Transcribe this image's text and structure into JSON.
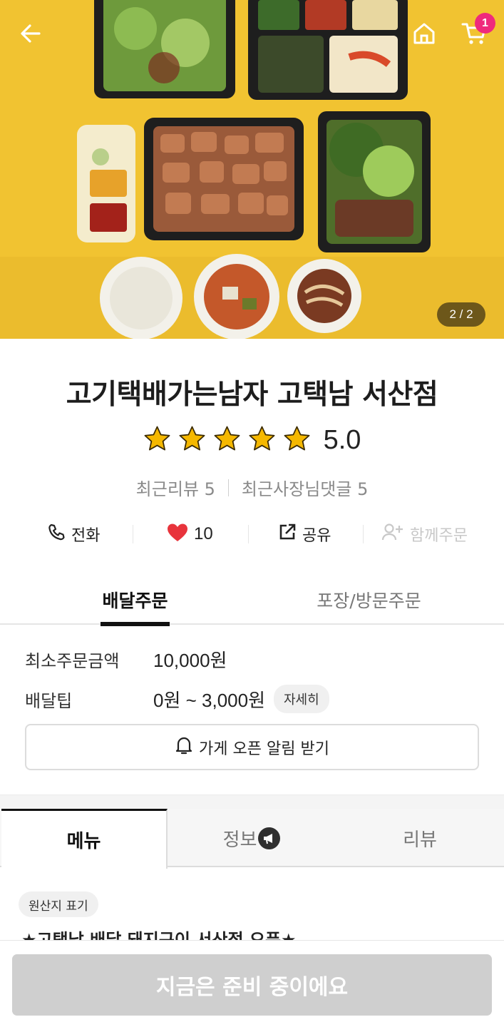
{
  "hero": {
    "page_indicator": "2 / 2",
    "cart_count": "1",
    "icons": {
      "back": "arrow-left-icon",
      "home": "home-icon",
      "cart": "cart-icon"
    }
  },
  "store": {
    "name": "고기택배가는남자 고택남 서산점",
    "rating": "5.0",
    "stars": 5,
    "recent_reviews": "최근리뷰 5",
    "recent_owner_replies": "최근사장님댓글 5"
  },
  "actions": {
    "call": "전화",
    "likes": "10",
    "share": "공유",
    "group_order": "함께주문"
  },
  "order_tabs": {
    "delivery": "배달주문",
    "pickup": "포장/방문주문"
  },
  "info": {
    "min_order_label": "최소주문금액",
    "min_order_value": "10,000원",
    "delivery_tip_label": "배달팁",
    "delivery_tip_value": "0원 ~ 3,000원",
    "detail_label": "자세히",
    "notify_label": "가게 오픈 알림 받기"
  },
  "main_tabs": {
    "menu": "메뉴",
    "info": "정보",
    "review": "리뷰"
  },
  "origin_label": "원산지 표기",
  "notice_partial": "★고택남 배달 돼지구이 서산점 오픈★",
  "bottom": {
    "status_button": "지금은 준비 중이에요"
  },
  "colors": {
    "hero_bg": "#f1c331",
    "badge": "#ef2a7c",
    "heart": "#e8343c",
    "star": "#f5b800",
    "disabled_button": "#cfcfcf"
  }
}
